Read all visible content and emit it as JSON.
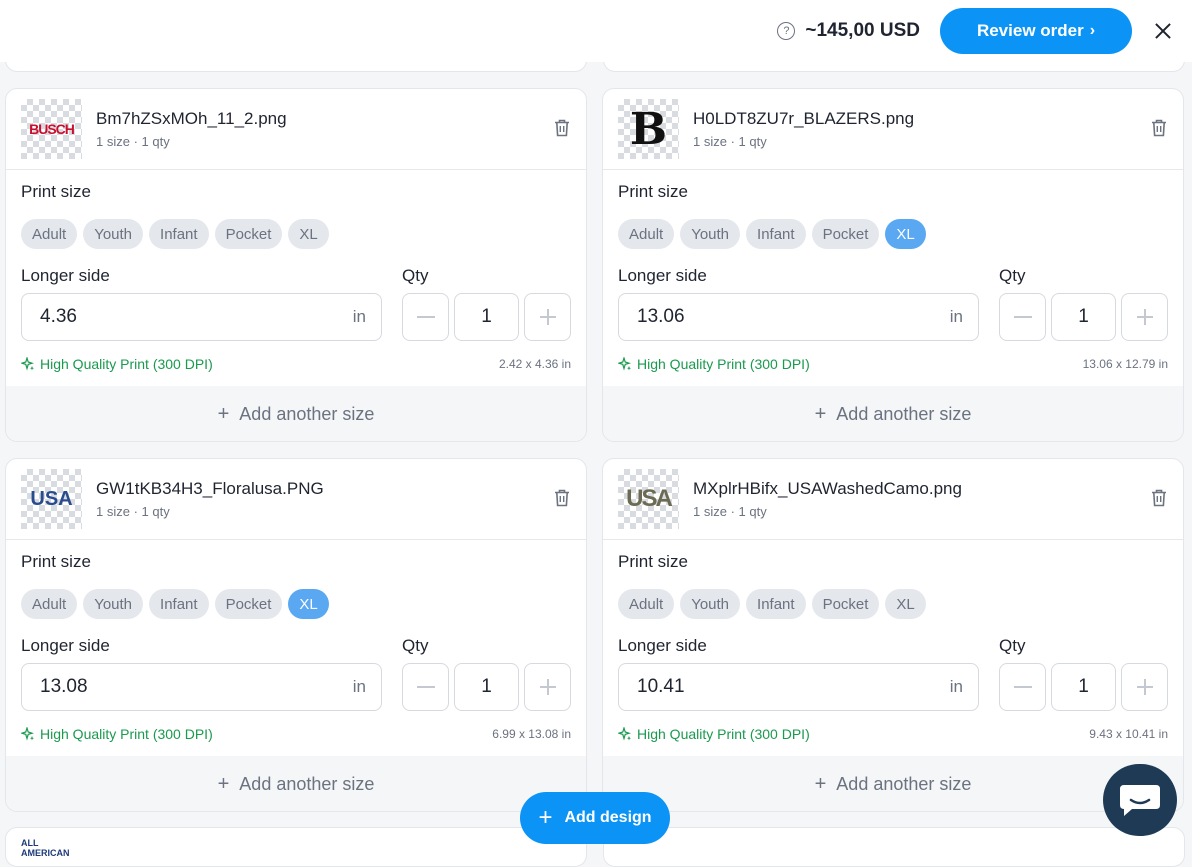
{
  "topbar": {
    "total": "~145,00 USD",
    "review_label": "Review order",
    "review_chevron": "›",
    "help_glyph": "?"
  },
  "labels": {
    "print_size": "Print size",
    "longer_side": "Longer side",
    "qty": "Qty",
    "unit": "in",
    "quality": "High Quality Print (300 DPI)",
    "add_size": "Add another size",
    "add_design": "Add design",
    "add_plus": "+"
  },
  "size_options": [
    "Adult",
    "Youth",
    "Infant",
    "Pocket",
    "XL"
  ],
  "designs": [
    {
      "filename": "Bm7hZSxMOh_11_2.png",
      "meta": "1 size · 1 qty",
      "selected_size": "",
      "longer_side": "4.36",
      "qty": "1",
      "dims": "2.42 x 4.36 in",
      "thumb_text": "BUSCH"
    },
    {
      "filename": "H0LDT8ZU7r_BLAZERS.png",
      "meta": "1 size · 1 qty",
      "selected_size": "XL",
      "longer_side": "13.06",
      "qty": "1",
      "dims": "13.06 x 12.79 in",
      "thumb_text": "B"
    },
    {
      "filename": "GW1tKB34H3_Floralusa.PNG",
      "meta": "1 size · 1 qty",
      "selected_size": "XL",
      "longer_side": "13.08",
      "qty": "1",
      "dims": "6.99 x 13.08 in",
      "thumb_text": "USA"
    },
    {
      "filename": "MXplrHBifx_USAWashedCamo.png",
      "meta": "1 size · 1 qty",
      "selected_size": "",
      "longer_side": "10.41",
      "qty": "1",
      "dims": "9.43 x 10.41 in",
      "thumb_text": "USA"
    }
  ],
  "colors": {
    "accent": "#0b93f6",
    "selected_chip": "#5aa7f2",
    "quality_green": "#1a9a4e",
    "chat": "#1e3a55"
  }
}
